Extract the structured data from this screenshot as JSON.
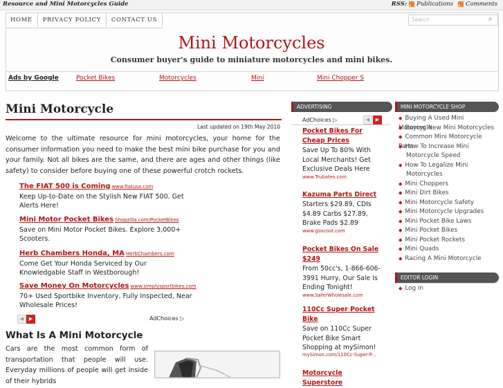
{
  "topbar": {
    "tagline": "Resource and Mini Motorcycles Guide",
    "rss_label": "RSS:",
    "publications": "Publications",
    "comments": "Comments"
  },
  "nav": {
    "items": [
      "HOME",
      "PRIVACY POLICY",
      "CONTACT US"
    ]
  },
  "search": {
    "placeholder": "Search"
  },
  "header": {
    "title": "Mini Motorcycles",
    "subtitle": "Consumer buyer's guide to miniature motorcycles and mini bikes."
  },
  "adbar": {
    "ads_by": "Ads by Google",
    "links": [
      "Pocket Bikes",
      "Motorcycles",
      "Mini",
      "Mini Chopper S"
    ]
  },
  "main": {
    "title": "Mini Motorcycle",
    "last_updated": "Last updated on 19th May 2010",
    "intro": "Welcome to the ultimate resource for mini motorcycles, your home for the consumer information you need to make the best mini bike purchase for you and your family. Not all bikes are the same, and there are ages and other things (like safety) to consider before buying one of these powerful crotch rockets.",
    "ads": [
      {
        "title": "The FIAT 500 is Coming",
        "url": "www.fiatusa.com",
        "text": "Keep Up-to-Date on the Stylish New FIAT 500. Get Alerts Here!"
      },
      {
        "title": "Mini Motor Pocket Bikes",
        "url": "Shopzilla.com/PocketBikes",
        "text": "Save on Mini Motor Pocket Bikes. Explore 3,000+ Scooters."
      },
      {
        "title": "Herb Chambers Honda, MA",
        "url": "HerbChambers.com",
        "text": "Come Get Your Honda Serviced by Our Knowledgable Staff in Westborough!"
      },
      {
        "title": "Save Money On Motorcycles",
        "url": "www.simplysportbikes.com",
        "text": "70+ Used Sportbike Inventory, Fully Inspected, Near Wholesale Prices!"
      }
    ],
    "adchoices": "AdChoices",
    "section_heading": "What Is A Mini Motorcycle",
    "section_text": "Cars are the most common form of transportation that people will use. Everyday millions of people will get inside of their hybrids"
  },
  "advertising": {
    "heading": "ADVERTISING",
    "adchoices": "AdChoices",
    "ads": [
      {
        "title": "Pocket Bikes For Cheap Prices",
        "text": "Save Up To 80% With Local Merchants! Get Exclusive Deals Here",
        "url": "www.Trubates.com"
      },
      {
        "title": "Kazuma Parts Direct",
        "text": "Starters $29.89, CDIs $4.89 Carbs $27.89, Brake Pads $2.89",
        "url": "www.goscoot.com"
      },
      {
        "title": "Pocket Bikes On Sale $249",
        "text": "From 50cc's, 1-866-606-3991 Hurry, Our Sale Is Ending Tonight!",
        "url": "www.SaferWholesale.com"
      },
      {
        "title": "110Cc Super Pocket Bike",
        "text": "Save on 110Cc Super Pocket Bike Smart Shopping at mySimon!",
        "url": "mySimon.com/110Cc-Super-P..."
      },
      {
        "title": "Motorcycle Superstore",
        "text": "",
        "url": ""
      }
    ]
  },
  "shop": {
    "heading": "MINI MOTORCYCLE SHOP",
    "items": [
      [
        "Buying A Used Mini Motorcycle"
      ],
      [
        "Buying New Mini Motorcycles"
      ],
      [
        "Common Mini Motorcycle Parts"
      ],
      [
        "How To Increase Mini",
        "Motorcycle Speed"
      ],
      [
        "How To Legalize Mini",
        "Motorcycles"
      ],
      [
        "Mini Choppers"
      ],
      [
        "Mini Dirt Bikes"
      ],
      [
        "Mini Motorcycle Safety"
      ],
      [
        "Mini Motorcycle Upgrades"
      ],
      [
        "Mini Pocket Bike Laws"
      ],
      [
        "Mini Pocket Bikes"
      ],
      [
        "Mini Pocket Rockets"
      ],
      [
        "Mini Quads"
      ],
      [
        "Racing A Mini Motorcycle"
      ]
    ]
  },
  "editor": {
    "heading": "EDITOR LOGIN",
    "items": [
      "Log in"
    ]
  },
  "colors": {
    "accent": "#b21414",
    "heading_bg": "#555555"
  }
}
